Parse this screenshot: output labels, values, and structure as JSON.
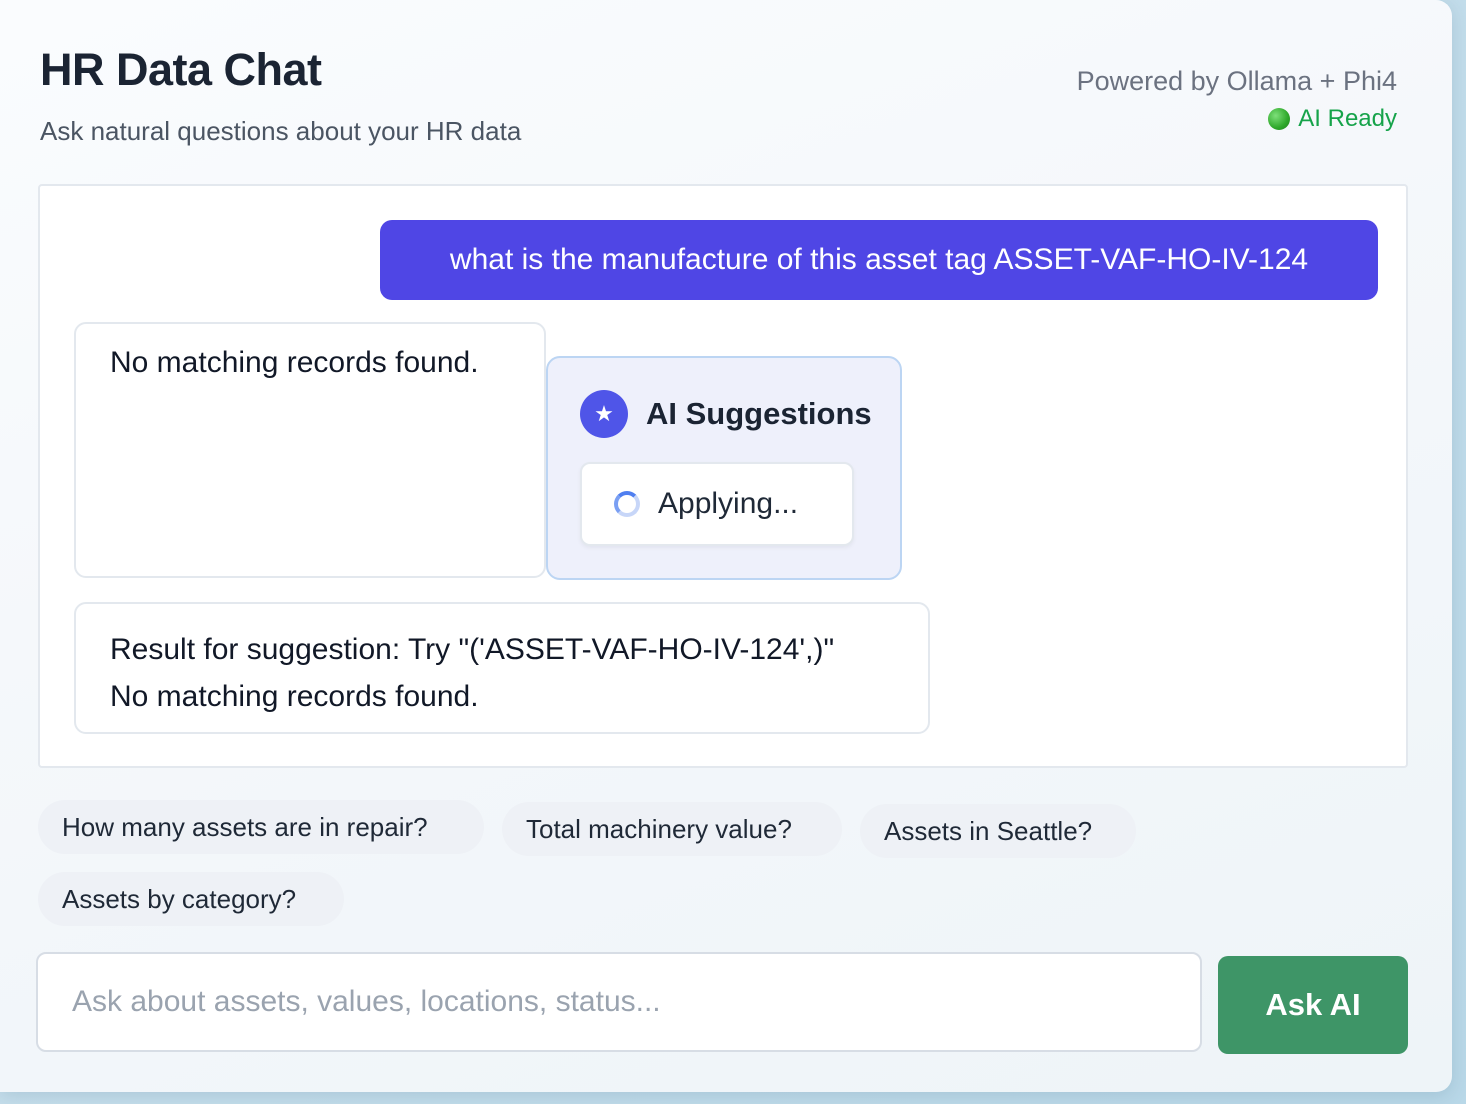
{
  "header": {
    "title": "HR Data Chat",
    "subtitle": "Ask natural questions about your HR data",
    "powered_by": "Powered by Ollama + Phi4",
    "status_text": "AI Ready",
    "status_color": "#16a34a"
  },
  "chat": {
    "user_message": "what is the manufacture of this asset tag ASSET-VAF-HO-IV-124",
    "bot_reply_1": "No matching records found.",
    "suggestions_panel": {
      "title": "AI Suggestions",
      "icon": "star-icon",
      "applying_label": "Applying..."
    },
    "bot_reply_2": {
      "line1": "Result for suggestion: Try \"('ASSET-VAF-HO-IV-124',)\"",
      "line2": "No matching records found."
    }
  },
  "quick_questions": [
    "How many assets are in repair?",
    "Total machinery value?",
    "Assets in Seattle?",
    "Assets by category?"
  ],
  "input": {
    "placeholder": "Ask about assets, values, locations, status...",
    "value": ""
  },
  "submit_label": "Ask AI",
  "colors": {
    "accent": "#4f46e5",
    "button": "#3e9567"
  }
}
